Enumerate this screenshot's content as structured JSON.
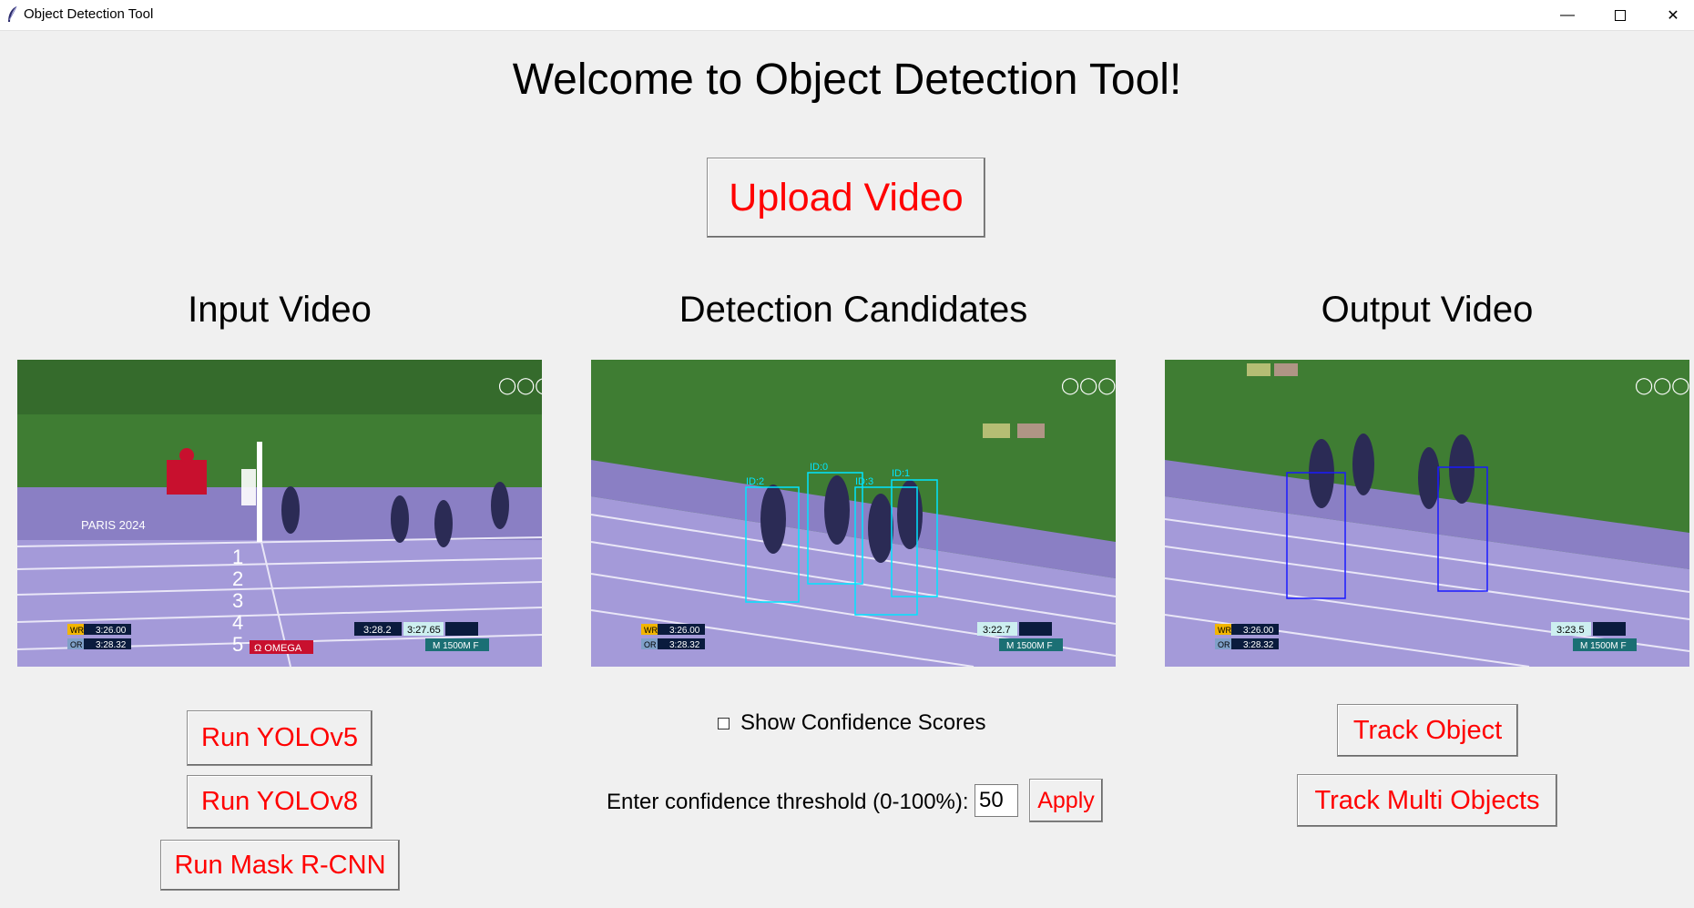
{
  "window": {
    "title": "Object Detection Tool",
    "min_label": "—",
    "close_label": "✕"
  },
  "header": {
    "welcome": "Welcome to Object Detection Tool!",
    "upload_label": "Upload Video"
  },
  "sections": {
    "input_title": "Input Video",
    "candidates_title": "Detection Candidates",
    "output_title": "Output Video"
  },
  "video_overlays": {
    "wr_tag": "WR",
    "wr_time": "3:26.00",
    "or_tag": "OR",
    "or_time": "3:28.32",
    "event": "M 1500M F",
    "paris": "PARIS 2024",
    "omega": "Ω OMEGA",
    "input_clock_a": "3:28.2",
    "input_clock_b": "3:27.65",
    "candidates_clock": "3:22.7",
    "output_clock": "3:23.5",
    "lane_numbers": [
      "1",
      "2",
      "3",
      "4",
      "5"
    ]
  },
  "detections": [
    {
      "label": "ID:2",
      "color": "#00e5ff"
    },
    {
      "label": "ID:0",
      "color": "#00e5ff"
    },
    {
      "label": "ID:3",
      "color": "#00e5ff"
    },
    {
      "label": "ID:1",
      "color": "#00e5ff"
    }
  ],
  "left_controls": {
    "yolov5_label": "Run YOLOv5",
    "yolov8_label": "Run YOLOv8",
    "maskrcnn_label": "Run Mask R-CNN"
  },
  "center_controls": {
    "show_scores_label": "Show Confidence Scores",
    "show_scores_checked": false,
    "threshold_label": "Enter confidence threshold (0-100%):",
    "threshold_value": "50",
    "apply_label": "Apply"
  },
  "right_controls": {
    "track_label": "Track Object",
    "track_multi_label": "Track Multi Objects"
  },
  "colors": {
    "button_text": "#ff0000",
    "track_green": "#3f7d33",
    "track_purple": "#a49ad9",
    "detection_box": "#00e5ff",
    "tracking_box": "#1a1aff"
  }
}
